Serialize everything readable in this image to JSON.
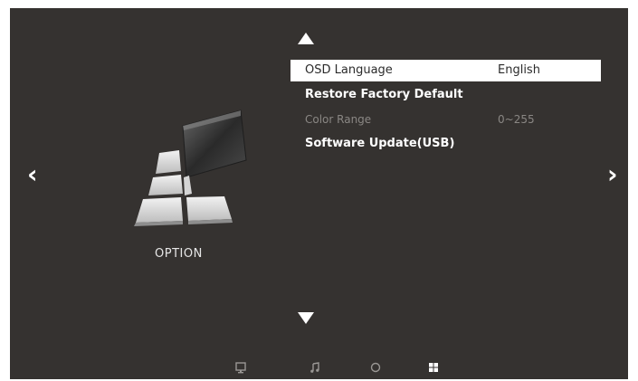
{
  "option_label": "OPTION",
  "menu": {
    "items": [
      {
        "label": "OSD Language",
        "value": "English"
      },
      {
        "label": "Restore Factory Default",
        "value": ""
      },
      {
        "label": "Color Range",
        "value": "0~255"
      },
      {
        "label": "Software Update(USB)",
        "value": ""
      }
    ]
  },
  "nav": {
    "left_arrow": "‹",
    "right_arrow": "›"
  },
  "bottom_icons": [
    "monitor-icon",
    "music-note-icon",
    "circle-icon",
    "option-square-icon"
  ],
  "colors": {
    "background": "#353230",
    "text": "#ffffff",
    "disabled_text": "#8a8784",
    "selected_bg": "#ffffff"
  }
}
